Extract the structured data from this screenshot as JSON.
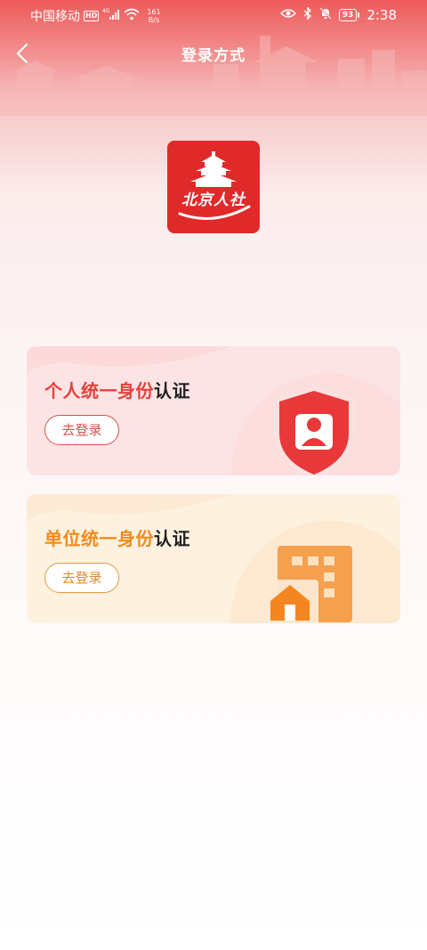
{
  "status_bar": {
    "carrier": "中国移动",
    "hd": "HD",
    "signal_type": "4G",
    "speed_value": "161",
    "speed_unit": "B/s",
    "battery": "93",
    "time": "2:38"
  },
  "nav": {
    "title": "登录方式"
  },
  "logo": {
    "text": "北京人社"
  },
  "cards": [
    {
      "title_highlight": "个人统一身份",
      "title_rest": "认证",
      "button_label": "去登录",
      "accent_color": "#e4413c",
      "icon": "shield-user-icon"
    },
    {
      "title_highlight": "单位统一身份",
      "title_rest": "认证",
      "button_label": "去登录",
      "accent_color": "#f08a1c",
      "icon": "building-home-icon"
    }
  ]
}
